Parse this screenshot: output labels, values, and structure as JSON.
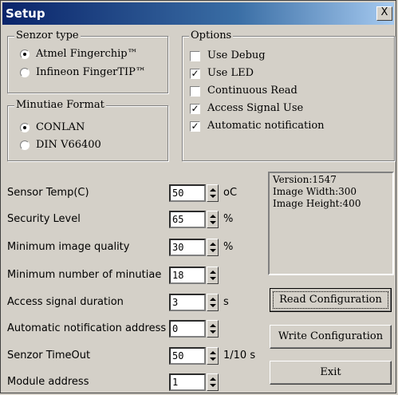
{
  "window": {
    "title": "Setup",
    "close_label": "X"
  },
  "sensor_type": {
    "label": "Senzor type",
    "options": [
      {
        "label": "Atmel Fingerchip™",
        "selected": true
      },
      {
        "label": "Infineon FingerTIP™",
        "selected": false
      }
    ]
  },
  "minutiae_format": {
    "label": "Minutiae Format",
    "options": [
      {
        "label": "CONLAN",
        "selected": true
      },
      {
        "label": "DIN V66400",
        "selected": false
      }
    ]
  },
  "options": {
    "label": "Options",
    "items": [
      {
        "label": "Use Debug",
        "checked": false
      },
      {
        "label": "Use LED",
        "checked": true
      },
      {
        "label": "Continuous Read",
        "checked": false
      },
      {
        "label": "Access Signal Use",
        "checked": true
      },
      {
        "label": "Automatic notification",
        "checked": true
      }
    ]
  },
  "fields": [
    {
      "label": "Sensor Temp(C)",
      "value": "50",
      "unit": "oC"
    },
    {
      "label": "Security Level",
      "value": "65",
      "unit": "%"
    },
    {
      "label": "Minimum image quality",
      "value": "30",
      "unit": "%"
    },
    {
      "label": "Minimum number of minutiae",
      "value": "18",
      "unit": ""
    },
    {
      "label": "Access signal duration",
      "value": "3",
      "unit": "s"
    },
    {
      "label": "Automatic notification address",
      "value": "0",
      "unit": ""
    },
    {
      "label": "Senzor TimeOut",
      "value": "50",
      "unit": "1/10 s"
    },
    {
      "label": "Module address",
      "value": "1",
      "unit": ""
    }
  ],
  "info": {
    "version": "Version:1547",
    "image_width": "Image Width:300",
    "image_height": "Image Height:400"
  },
  "buttons": {
    "read": "Read Configuration",
    "write": "Write Configuration",
    "exit": "Exit"
  }
}
